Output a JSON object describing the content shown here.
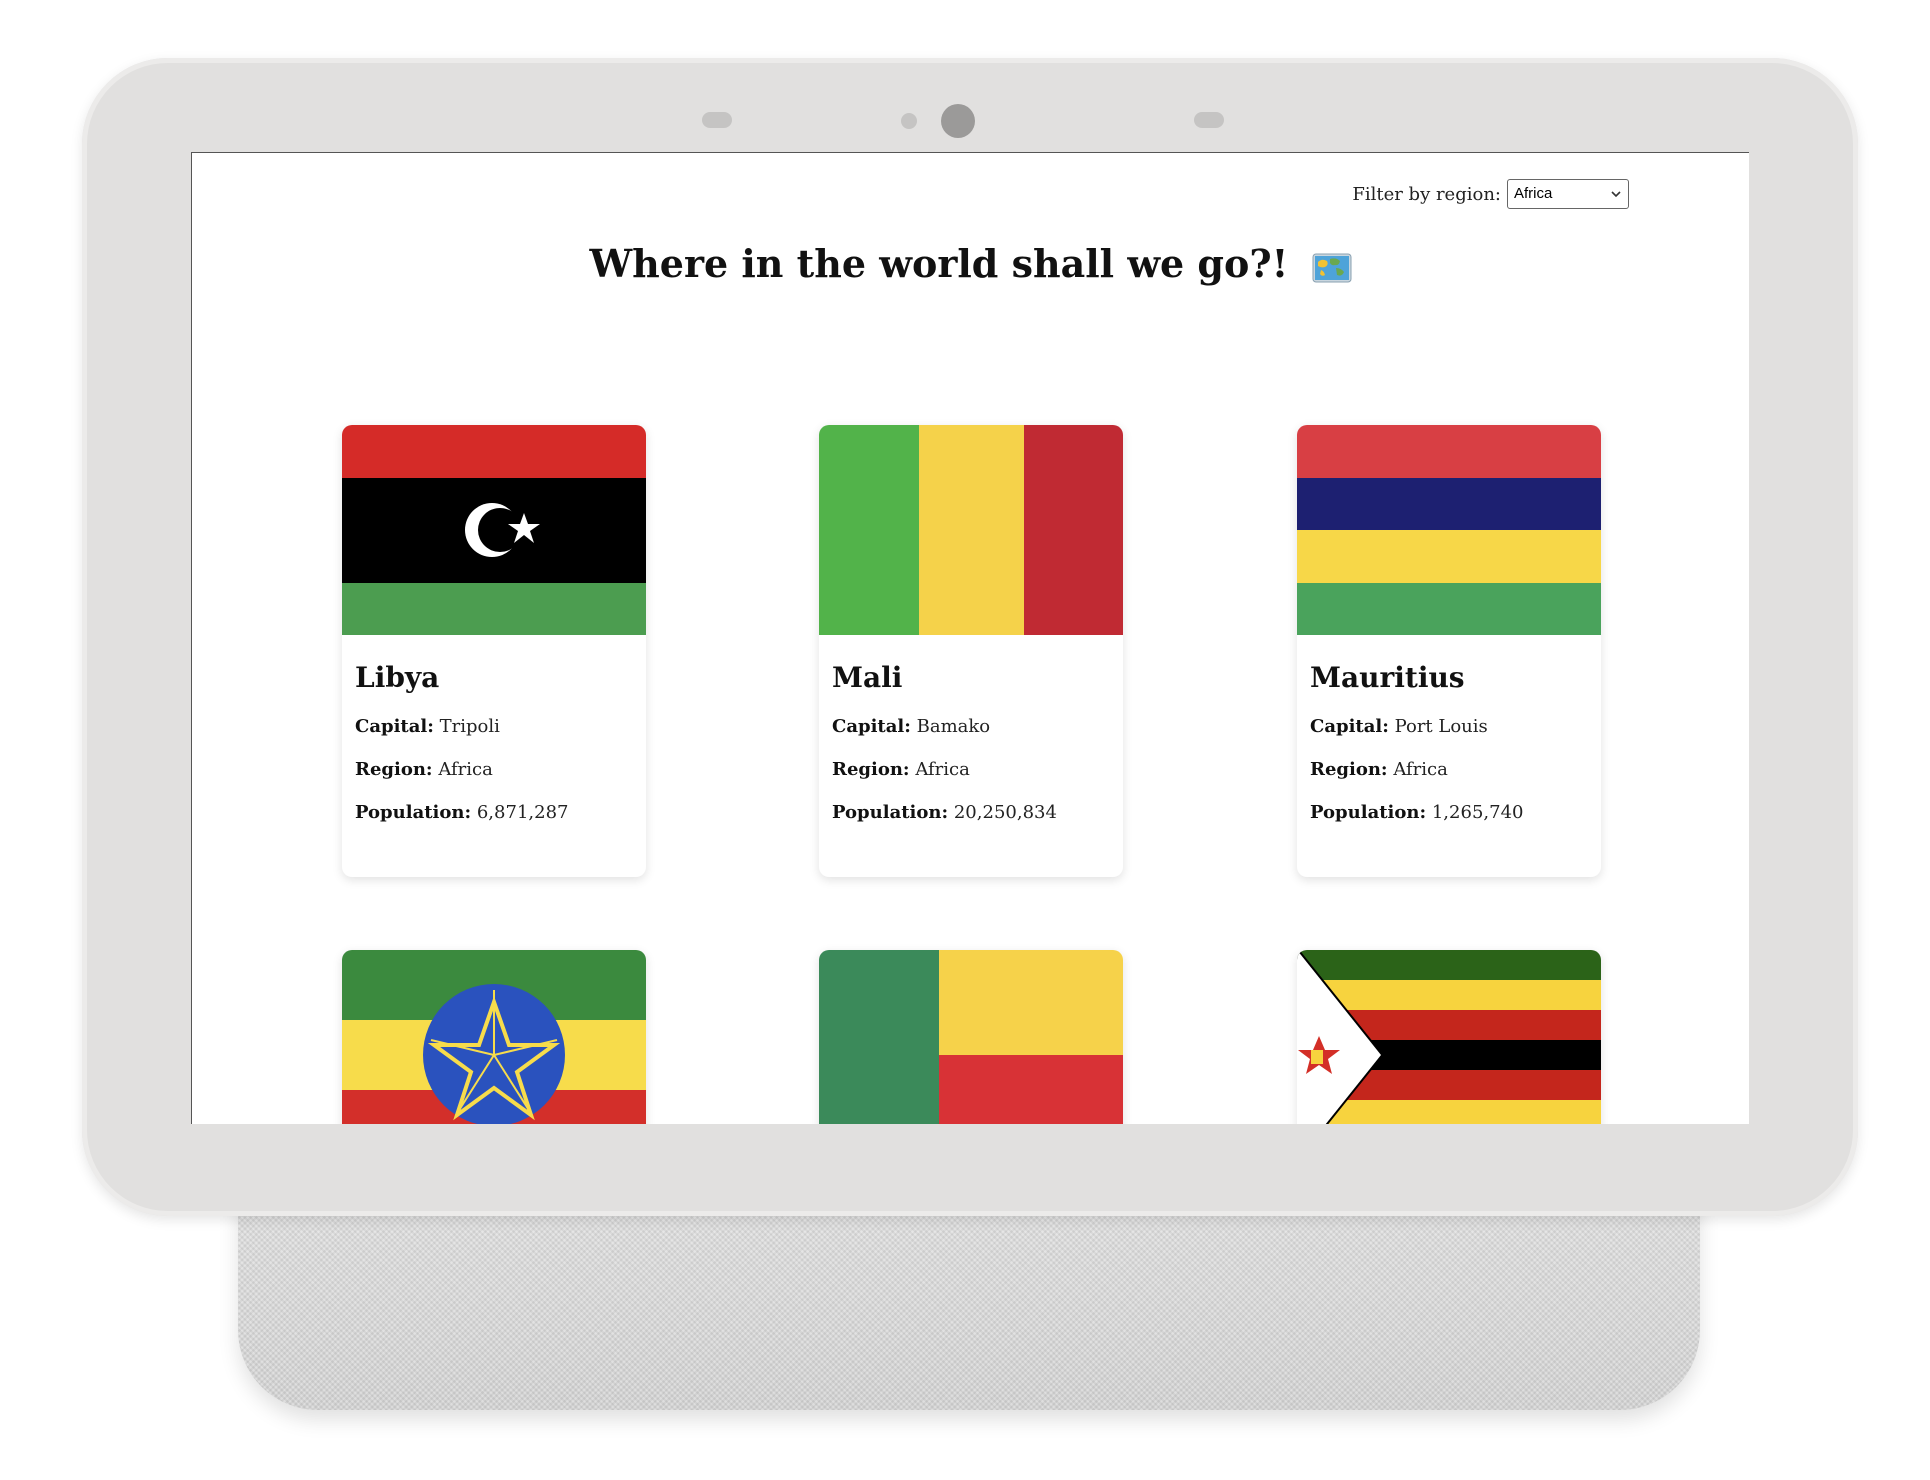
{
  "filter": {
    "label": "Filter by region:",
    "selected": "Africa"
  },
  "title": "Where in the world shall we go?!",
  "labels": {
    "capital": "Capital:",
    "region": "Region:",
    "population": "Population:"
  },
  "countries": [
    {
      "name": "Libya",
      "capital": "Tripoli",
      "region": "Africa",
      "population": "6,871,287",
      "flag_icon": "libya-flag-icon"
    },
    {
      "name": "Mali",
      "capital": "Bamako",
      "region": "Africa",
      "population": "20,250,834",
      "flag_icon": "mali-flag-icon"
    },
    {
      "name": "Mauritius",
      "capital": "Port Louis",
      "region": "Africa",
      "population": "1,265,740",
      "flag_icon": "mauritius-flag-icon"
    },
    {
      "flag_icon": "ethiopia-flag-icon"
    },
    {
      "flag_icon": "benin-flag-icon"
    },
    {
      "flag_icon": "zimbabwe-flag-icon"
    }
  ],
  "colors": {
    "bezel": "#e1e0df",
    "screen": "#ffffff",
    "text": "#111111"
  }
}
